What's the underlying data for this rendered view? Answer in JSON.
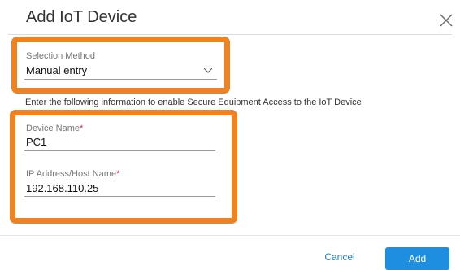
{
  "dialog": {
    "title": "Add IoT Device",
    "close_icon": "close-icon"
  },
  "selection_method": {
    "label": "Selection Method",
    "value": "Manual entry",
    "chevron_icon": "chevron-down-icon"
  },
  "info_text": "Enter the following information to enable Secure Equipment Access to the IoT Device",
  "device_name": {
    "label": "Device Name",
    "required_marker": "*",
    "value": "PC1"
  },
  "ip_address": {
    "label": "IP Address/Host Name",
    "required_marker": "*",
    "value": "192.168.110.25"
  },
  "footer": {
    "cancel_label": "Cancel",
    "add_label": "Add"
  },
  "colors": {
    "highlight": "#f0821f",
    "primary": "#1d8ee0",
    "link": "#1d7fd8",
    "required": "#e0264a"
  }
}
